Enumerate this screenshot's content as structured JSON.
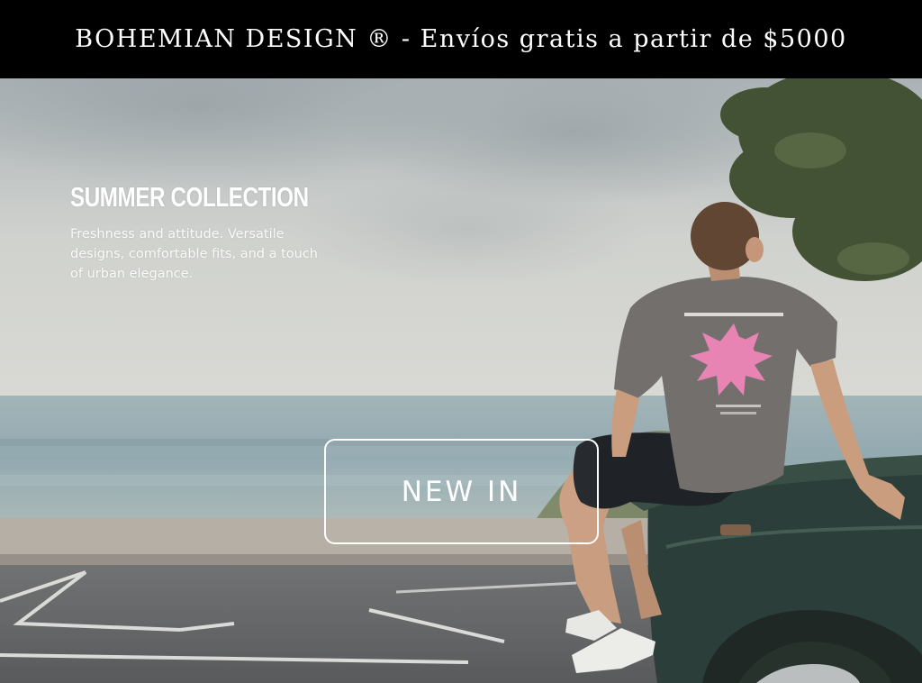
{
  "announcement": {
    "text": "BOHEMIAN DESIGN ® - Envíos gratis a partir de $5000"
  },
  "hero": {
    "title": "SUMMER COLLECTION",
    "description": "Freshness and attitude. Versatile designs, comfortable fits, and a touch of urban elegance.",
    "cta_label": "NEW IN",
    "shirt_print_color": "#e87fb0"
  }
}
